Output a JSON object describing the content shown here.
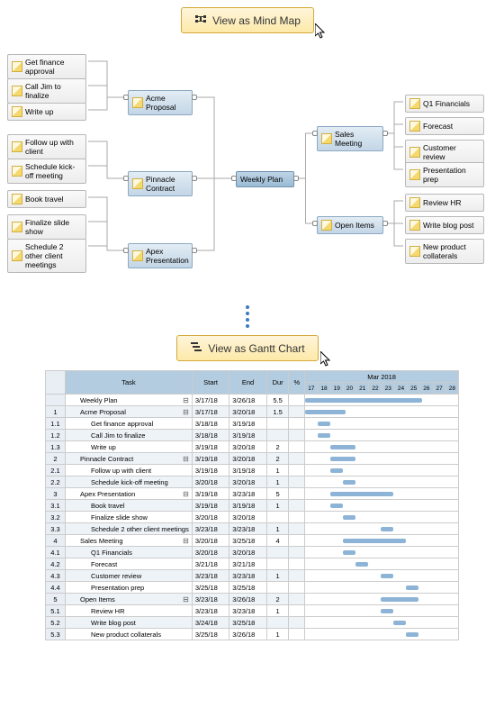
{
  "buttons": {
    "mindmap": "View as Mind Map",
    "gantt": "View as Gantt Chart"
  },
  "mindmap": {
    "center": "Weekly Plan",
    "left_mid": [
      {
        "label": "Acme Proposal",
        "children": [
          "Get finance approval",
          "Call Jim to finalize",
          "Write up"
        ]
      },
      {
        "label": "Pinnacle Contract",
        "children": [
          "Follow up with client",
          "Schedule kick-off meeting"
        ]
      },
      {
        "label": "Apex Presentation",
        "children": [
          "Book travel",
          "Finalize slide show",
          "Schedule 2 other client meetings"
        ]
      }
    ],
    "right_mid": [
      {
        "label": "Sales Meeting",
        "children": [
          "Q1 Financials",
          "Forecast",
          "Customer review",
          "Presentation prep"
        ]
      },
      {
        "label": "Open Items",
        "children": [
          "Review HR",
          "Write blog post",
          "New product collaterals"
        ]
      }
    ]
  },
  "gantt": {
    "header_month": "Mar 2018",
    "cols": [
      "Task",
      "Start",
      "End",
      "Dur",
      "%"
    ],
    "days": [
      "17",
      "18",
      "19",
      "20",
      "21",
      "22",
      "23",
      "24",
      "25",
      "26",
      "27",
      "28"
    ],
    "rows": [
      {
        "num": "",
        "task": "Weekly Plan",
        "indent": 1,
        "start": "3/17/18",
        "end": "3/26/18",
        "dur": "5.5",
        "pct": "",
        "bar": [
          0,
          130
        ],
        "coll": true
      },
      {
        "num": "1",
        "task": "Acme Proposal",
        "indent": 1,
        "start": "3/17/18",
        "end": "3/20/18",
        "dur": "1.5",
        "pct": "",
        "bar": [
          0,
          45
        ],
        "coll": true
      },
      {
        "num": "1.1",
        "task": "Get finance approval",
        "indent": 2,
        "start": "3/18/18",
        "end": "3/19/18",
        "dur": "",
        "pct": "",
        "bar": [
          14,
          14
        ]
      },
      {
        "num": "1.2",
        "task": "Call Jim to finalize",
        "indent": 2,
        "start": "3/18/18",
        "end": "3/19/18",
        "dur": "",
        "pct": "",
        "bar": [
          14,
          14
        ]
      },
      {
        "num": "1.3",
        "task": "Write up",
        "indent": 2,
        "start": "3/19/18",
        "end": "3/20/18",
        "dur": "2",
        "pct": "",
        "bar": [
          28,
          28
        ]
      },
      {
        "num": "2",
        "task": "Pinnacle Contract",
        "indent": 1,
        "start": "3/19/18",
        "end": "3/20/18",
        "dur": "2",
        "pct": "",
        "bar": [
          28,
          28
        ],
        "coll": true
      },
      {
        "num": "2.1",
        "task": "Follow up with client",
        "indent": 2,
        "start": "3/19/18",
        "end": "3/19/18",
        "dur": "1",
        "pct": "",
        "bar": [
          28,
          14
        ]
      },
      {
        "num": "2.2",
        "task": "Schedule kick-off meeting",
        "indent": 2,
        "start": "3/20/18",
        "end": "3/20/18",
        "dur": "1",
        "pct": "",
        "bar": [
          42,
          14
        ]
      },
      {
        "num": "3",
        "task": "Apex Presentation",
        "indent": 1,
        "start": "3/19/18",
        "end": "3/23/18",
        "dur": "5",
        "pct": "",
        "bar": [
          28,
          70
        ],
        "coll": true
      },
      {
        "num": "3.1",
        "task": "Book travel",
        "indent": 2,
        "start": "3/19/18",
        "end": "3/19/18",
        "dur": "1",
        "pct": "",
        "bar": [
          28,
          14
        ]
      },
      {
        "num": "3.2",
        "task": "Finalize slide show",
        "indent": 2,
        "start": "3/20/18",
        "end": "3/20/18",
        "dur": "",
        "pct": "",
        "bar": [
          42,
          14
        ]
      },
      {
        "num": "3.3",
        "task": "Schedule 2 other client meetings",
        "indent": 2,
        "start": "3/23/18",
        "end": "3/23/18",
        "dur": "1",
        "pct": "",
        "bar": [
          84,
          14
        ]
      },
      {
        "num": "4",
        "task": "Sales Meeting",
        "indent": 1,
        "start": "3/20/18",
        "end": "3/25/18",
        "dur": "4",
        "pct": "",
        "bar": [
          42,
          70
        ],
        "coll": true
      },
      {
        "num": "4.1",
        "task": "Q1 Financials",
        "indent": 2,
        "start": "3/20/18",
        "end": "3/20/18",
        "dur": "",
        "pct": "",
        "bar": [
          42,
          14
        ]
      },
      {
        "num": "4.2",
        "task": "Forecast",
        "indent": 2,
        "start": "3/21/18",
        "end": "3/21/18",
        "dur": "",
        "pct": "",
        "bar": [
          56,
          14
        ]
      },
      {
        "num": "4.3",
        "task": "Customer review",
        "indent": 2,
        "start": "3/23/18",
        "end": "3/23/18",
        "dur": "1",
        "pct": "",
        "bar": [
          84,
          14
        ]
      },
      {
        "num": "4.4",
        "task": "Presentation prep",
        "indent": 2,
        "start": "3/25/18",
        "end": "3/25/18",
        "dur": "",
        "pct": "",
        "bar": [
          112,
          14
        ]
      },
      {
        "num": "5",
        "task": "Open Items",
        "indent": 1,
        "start": "3/23/18",
        "end": "3/26/18",
        "dur": "2",
        "pct": "",
        "bar": [
          84,
          42
        ],
        "coll": true
      },
      {
        "num": "5.1",
        "task": "Review HR",
        "indent": 2,
        "start": "3/23/18",
        "end": "3/23/18",
        "dur": "1",
        "pct": "",
        "bar": [
          84,
          14
        ]
      },
      {
        "num": "5.2",
        "task": "Write blog post",
        "indent": 2,
        "start": "3/24/18",
        "end": "3/25/18",
        "dur": "",
        "pct": "",
        "bar": [
          98,
          14
        ]
      },
      {
        "num": "5.3",
        "task": "New product collaterals",
        "indent": 2,
        "start": "3/25/18",
        "end": "3/26/18",
        "dur": "1",
        "pct": "",
        "bar": [
          112,
          14
        ]
      }
    ]
  }
}
